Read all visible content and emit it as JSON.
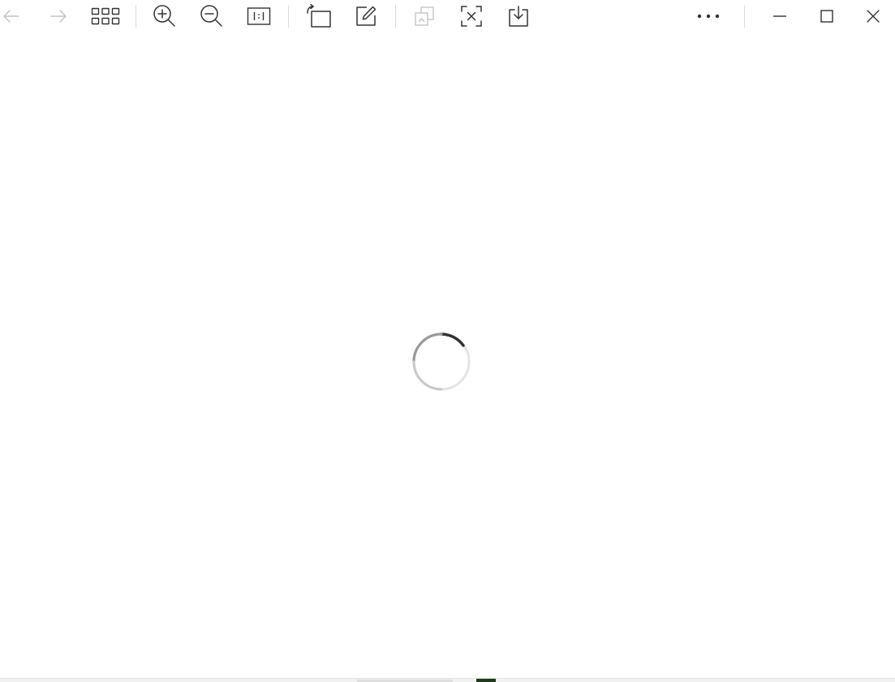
{
  "window": {
    "app": "image-viewer"
  },
  "toolbar": {
    "items": [
      {
        "name": "back-button",
        "icon": "arrow-left-icon",
        "enabled": false
      },
      {
        "name": "forward-button",
        "icon": "arrow-right-icon",
        "enabled": false
      },
      {
        "name": "gallery-button",
        "icon": "grid-icon",
        "enabled": true
      },
      {
        "name": "zoom-in-button",
        "icon": "zoom-in-icon",
        "enabled": true
      },
      {
        "name": "zoom-out-button",
        "icon": "zoom-out-icon",
        "enabled": true
      },
      {
        "name": "actual-size-button",
        "icon": "actual-size-icon",
        "enabled": true
      },
      {
        "name": "rotate-button",
        "icon": "rotate-icon",
        "enabled": true
      },
      {
        "name": "edit-button",
        "icon": "edit-icon",
        "enabled": true
      },
      {
        "name": "copy-image-button",
        "icon": "copy-image-icon",
        "enabled": false
      },
      {
        "name": "extract-text-button",
        "icon": "extract-text-icon",
        "enabled": true
      },
      {
        "name": "save-button",
        "icon": "download-icon",
        "enabled": true
      },
      {
        "name": "more-options-button",
        "icon": "more-horizontal-icon",
        "enabled": true
      }
    ]
  },
  "window_controls": {
    "minimize_icon": "minimize-icon",
    "maximize_icon": "maximize-icon",
    "close_icon": "close-icon"
  },
  "status": {
    "state": "loading",
    "spinner_icon": "loading-spinner-icon"
  },
  "colors": {
    "icon": "#333333",
    "icon_disabled": "#c4c4c4",
    "separator": "#dcdcdc",
    "background": "#ffffff",
    "spinner_track": "#d6d6d6",
    "spinner_arc": "#444444"
  }
}
